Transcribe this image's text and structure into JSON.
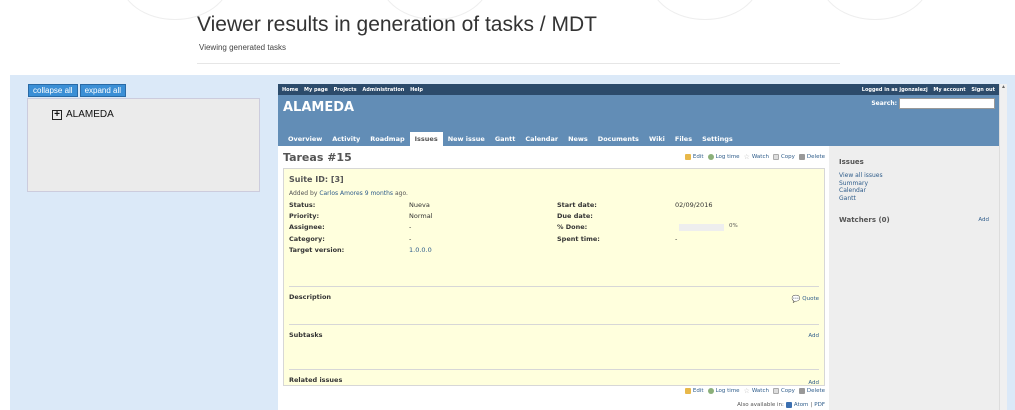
{
  "page": {
    "title": "Viewer results in generation of tasks / MDT",
    "subtitle": "Viewing generated tasks"
  },
  "tree": {
    "collapse_label": "collapse all",
    "expand_label": "expand all",
    "root_label": "ALAMEDA"
  },
  "redmine": {
    "topmenu": [
      "Home",
      "My page",
      "Projects",
      "Administration",
      "Help"
    ],
    "logged_in": "Logged in as jgonzalezj",
    "account_label": "My account",
    "signout_label": "Sign out",
    "project_title": "ALAMEDA",
    "search_label": "Search:",
    "tabs": [
      "Overview",
      "Activity",
      "Roadmap",
      "Issues",
      "New issue",
      "Gantt",
      "Calendar",
      "News",
      "Documents",
      "Wiki",
      "Files",
      "Settings"
    ],
    "active_tab": "Issues"
  },
  "issue": {
    "title": "Tareas #15",
    "actions": {
      "edit": "Edit",
      "log_time": "Log time",
      "watch": "Watch",
      "copy": "Copy",
      "delete": "Delete"
    },
    "subject": "Suite ID: [3]",
    "added_by_prefix": "Added by",
    "author": "Carlos Amores",
    "age": "9 months",
    "added_by_suffix": "ago.",
    "attributes": {
      "status_k": "Status:",
      "status_v": "Nueva",
      "priority_k": "Priority:",
      "priority_v": "Normal",
      "assignee_k": "Assignee:",
      "assignee_v": "-",
      "category_k": "Category:",
      "category_v": "-",
      "target_k": "Target version:",
      "target_v": "1.0.0.0",
      "start_k": "Start date:",
      "start_v": "02/09/2016",
      "due_k": "Due date:",
      "due_v": "",
      "done_k": "% Done:",
      "done_v": "0%",
      "done_fraction": 0,
      "spent_k": "Spent time:",
      "spent_v": "-"
    },
    "description_label": "Description",
    "quote_label": "Quote",
    "subtasks_label": "Subtasks",
    "related_label": "Related issues",
    "add_label": "Add",
    "also_available": "Also available in:",
    "atom_label": "Atom",
    "pdf_label": "PDF"
  },
  "sidebar": {
    "issues_heading": "Issues",
    "links": [
      "View all issues",
      "Summary",
      "Calendar",
      "Gantt"
    ],
    "watchers_heading": "Watchers (0)",
    "watchers_add": "Add"
  },
  "colors": {
    "header_blue": "#628db6",
    "topmenu": "#2c4b6b",
    "issue_bg": "#ffffdd",
    "tree_button": "#3b8fd6",
    "blue_area": "#dbe9f8"
  }
}
